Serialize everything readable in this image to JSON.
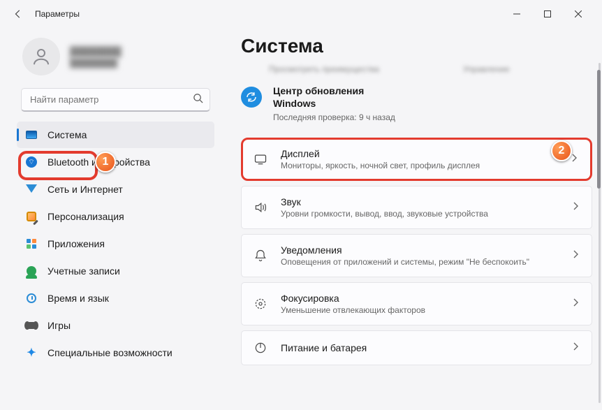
{
  "window": {
    "title": "Параметры"
  },
  "profile": {
    "name_placeholder": "████████",
    "email_placeholder": "████████"
  },
  "search": {
    "placeholder": "Найти параметр"
  },
  "sidebar": {
    "items": [
      {
        "label": "Система",
        "icon": "system",
        "active": true
      },
      {
        "label": "Bluetooth и устройства",
        "icon": "bluetooth"
      },
      {
        "label": "Сеть и Интернет",
        "icon": "network"
      },
      {
        "label": "Персонализация",
        "icon": "personalization"
      },
      {
        "label": "Приложения",
        "icon": "apps"
      },
      {
        "label": "Учетные записи",
        "icon": "accounts"
      },
      {
        "label": "Время и язык",
        "icon": "time"
      },
      {
        "label": "Игры",
        "icon": "gaming"
      },
      {
        "label": "Специальные возможности",
        "icon": "accessibility"
      }
    ]
  },
  "main": {
    "heading": "Система",
    "hint_left": "Просмотреть преимущества",
    "hint_right": "Управление",
    "update": {
      "line1": "Центр обновления",
      "line2": "Windows",
      "status": "Последняя проверка: 9 ч назад"
    },
    "cards": [
      {
        "title": "Дисплей",
        "subtitle": "Мониторы, яркость, ночной свет, профиль дисплея",
        "icon": "display",
        "highlight": true
      },
      {
        "title": "Звук",
        "subtitle": "Уровни громкости, вывод, ввод, звуковые устройства",
        "icon": "sound"
      },
      {
        "title": "Уведомления",
        "subtitle": "Оповещения от приложений и системы, режим \"Не беспокоить\"",
        "icon": "notifications"
      },
      {
        "title": "Фокусировка",
        "subtitle": "Уменьшение отвлекающих факторов",
        "icon": "focus"
      },
      {
        "title": "Питание и батарея",
        "subtitle": "",
        "icon": "power"
      }
    ]
  },
  "markers": {
    "one": "1",
    "two": "2"
  }
}
